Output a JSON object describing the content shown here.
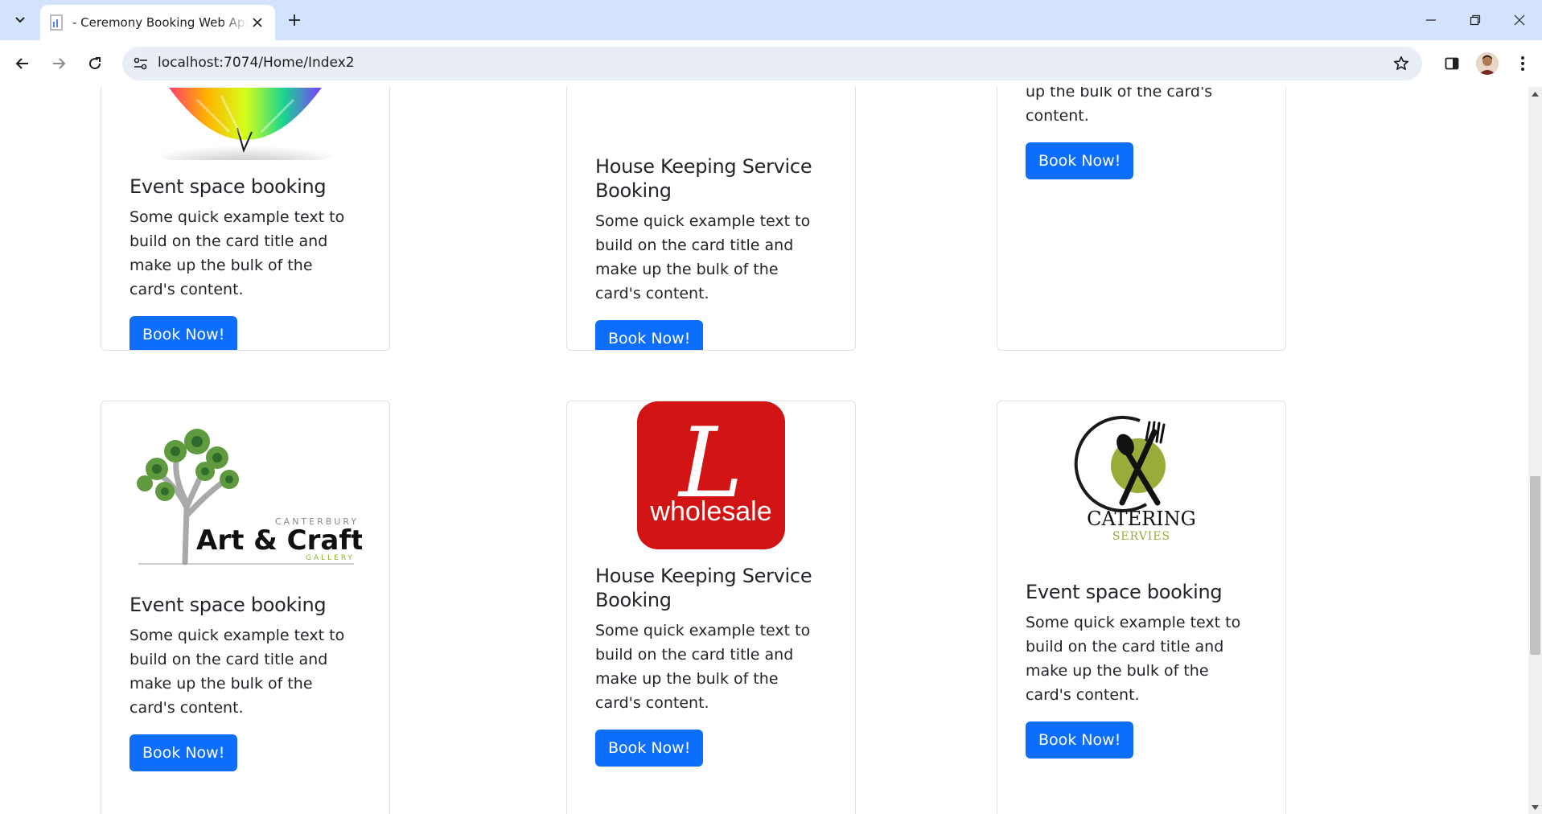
{
  "browser": {
    "tab_title": " - Ceremony Booking Web Application",
    "url": "localhost:7074/Home/Index2"
  },
  "cards": [
    {
      "title": "Event space booking",
      "text": "Some quick example text to build on the card title and make up the bulk of the card's content.",
      "button": "Book Now!"
    },
    {
      "title": "House Keeping Service Booking",
      "text": "Some quick example text to build on the card title and make up the bulk of the card's content.",
      "button": "Book Now!"
    },
    {
      "text_partial": "up the bulk of the card's content.",
      "button": "Book Now!"
    },
    {
      "title": "Event space booking",
      "text": "Some quick example text to build on the card title and make up the bulk of the card's content.",
      "button": "Book Now!",
      "logo": {
        "line1": "CANTERBURY",
        "line2": "Art & Craft",
        "line3": "GALLERY"
      }
    },
    {
      "title": "House Keeping Service Booking",
      "text": "Some quick example text to build on the card title and make up the bulk of the card's content.",
      "button": "Book Now!",
      "logo": {
        "letter": "L",
        "word": "wholesale"
      }
    },
    {
      "title": "Event space booking",
      "text": "Some quick example text to build on the card title and make up the bulk of the card's content.",
      "button": "Book Now!",
      "logo": {
        "word": "CATERING",
        "sub": "SERVIES"
      }
    }
  ],
  "colors": {
    "primary": "#0d6efd",
    "tab_bar": "#d3e3fd",
    "logo_red": "#d31414",
    "catering_green": "#9aab3a"
  }
}
